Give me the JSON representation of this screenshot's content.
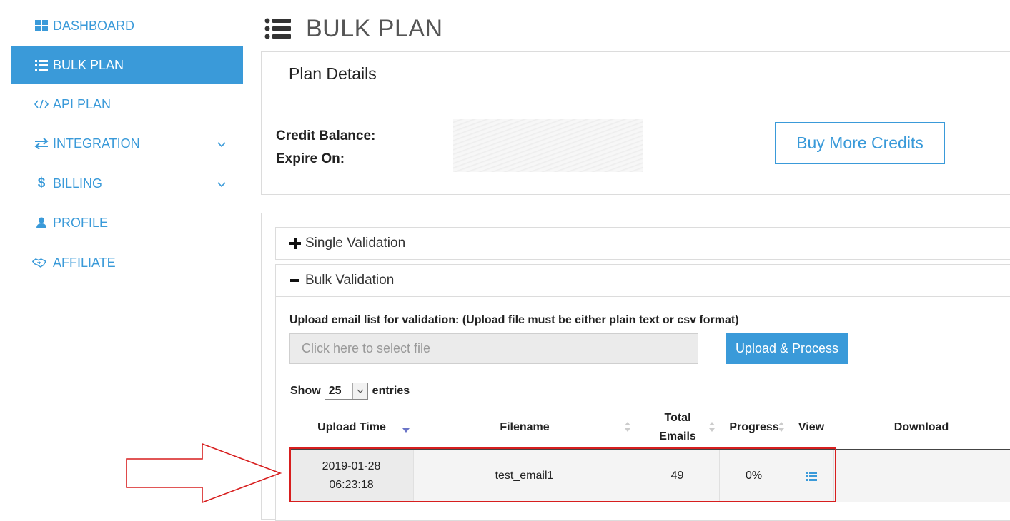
{
  "sidebar": {
    "items": [
      {
        "label": "DASHBOARD",
        "icon": "dashboard-icon"
      },
      {
        "label": "BULK PLAN",
        "icon": "list-icon",
        "active": true
      },
      {
        "label": "API PLAN",
        "icon": "code-icon"
      },
      {
        "label": "INTEGRATION",
        "icon": "exchange-icon",
        "has_submenu": true
      },
      {
        "label": "BILLING",
        "icon": "dollar-icon",
        "has_submenu": true
      },
      {
        "label": "PROFILE",
        "icon": "user-icon"
      },
      {
        "label": "AFFILIATE",
        "icon": "handshake-icon"
      }
    ]
  },
  "header": {
    "title": "BULK PLAN",
    "icon": "list-icon"
  },
  "plan_details": {
    "title": "Plan Details",
    "credit_balance_label": "Credit Balance:",
    "expire_on_label": "Expire On:",
    "buy_button": "Buy More Credits"
  },
  "validation": {
    "single_label": "Single Validation",
    "bulk_label": "Bulk Validation",
    "upload_label": "Upload email list for validation: (Upload file must be either plain text or csv format)",
    "file_placeholder": "Click here to select file",
    "upload_button": "Upload & Process",
    "show_label": "Show",
    "entries_value": "25",
    "entries_label": "entries"
  },
  "table": {
    "columns": [
      "Upload Time",
      "Filename",
      "Total Emails",
      "Progress",
      "View",
      "Download"
    ],
    "rows": [
      {
        "upload_date": "2019-01-28",
        "upload_time": "06:23:18",
        "filename": "test_email1",
        "total_emails": "49",
        "progress": "0%",
        "view_icon": "list-icon",
        "download": ""
      }
    ]
  },
  "colors": {
    "accent": "#3a9ad9",
    "highlight": "#d71e1e"
  }
}
